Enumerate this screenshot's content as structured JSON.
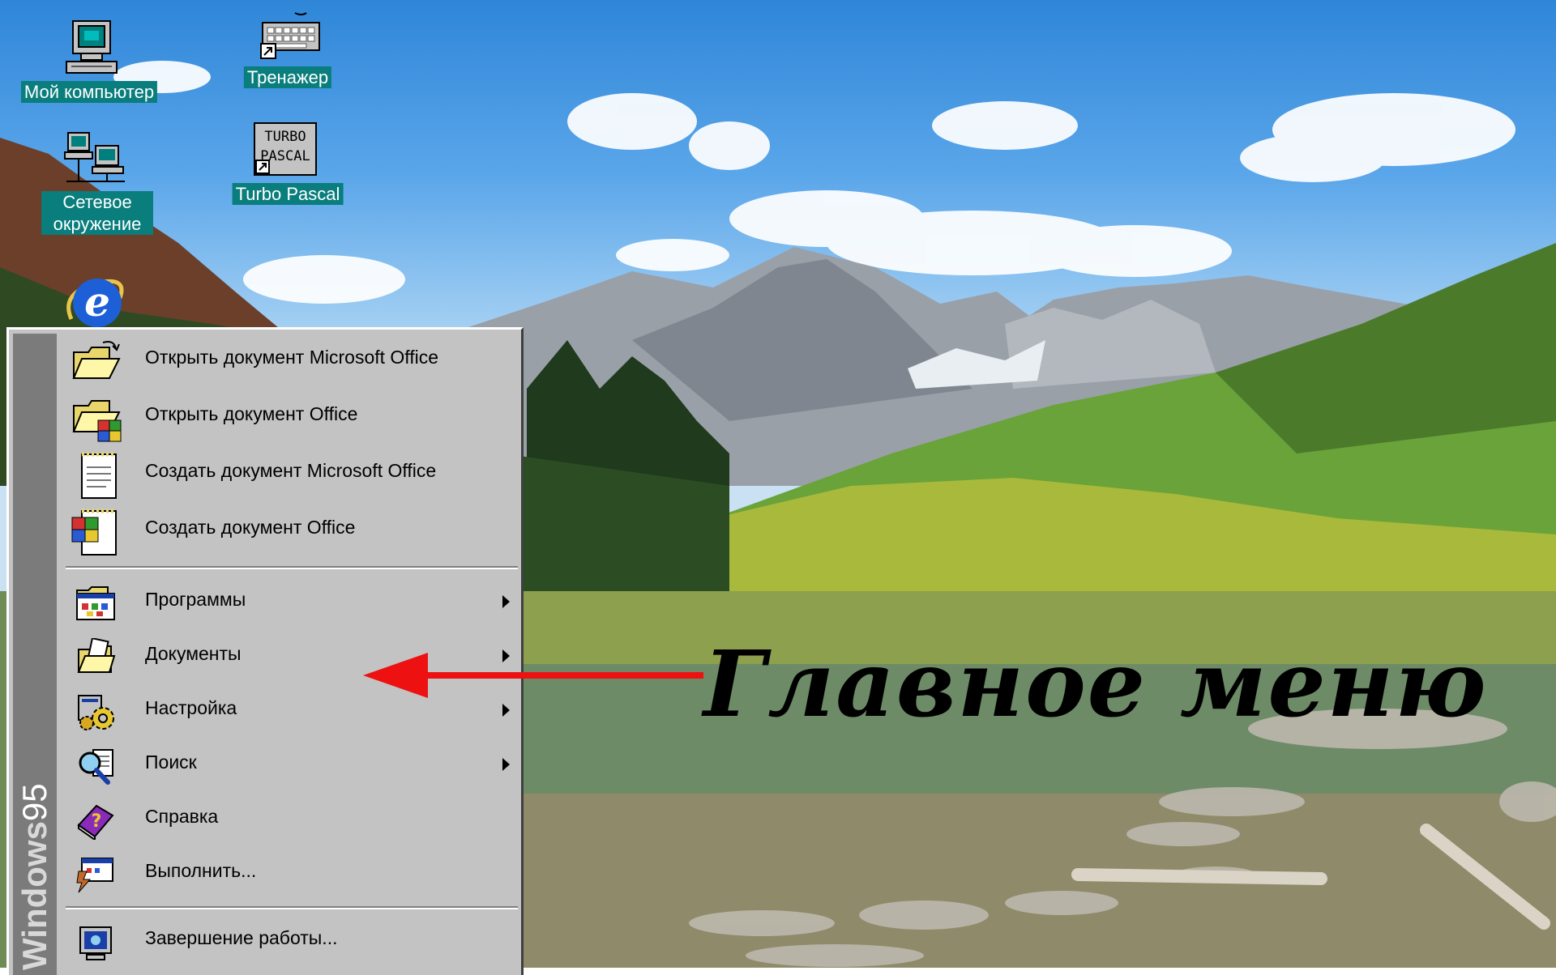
{
  "desktop": {
    "icons": [
      {
        "label": "Мой компьютер"
      },
      {
        "label": "Тренажер"
      },
      {
        "label": "Сетевое окружение"
      },
      {
        "label": "Turbo Pascal"
      }
    ],
    "turbo_pascal_logo": "TURBO PASCAL"
  },
  "start_menu": {
    "brand_bold": "Windows",
    "brand_version": "95",
    "office_items": [
      {
        "label": "Открыть документ Microsoft Office"
      },
      {
        "label": "Открыть документ Office"
      },
      {
        "label": "Создать документ Microsoft Office"
      },
      {
        "label": "Создать документ Office"
      }
    ],
    "items": [
      {
        "label": "Программы",
        "has_submenu": true
      },
      {
        "label": "Документы",
        "has_submenu": true
      },
      {
        "label": "Настройка",
        "has_submenu": true
      },
      {
        "label": "Поиск",
        "has_submenu": true
      },
      {
        "label": "Справка",
        "has_submenu": false
      },
      {
        "label": "Выполнить...",
        "has_submenu": false
      }
    ],
    "shutdown": {
      "label": "Завершение работы..."
    }
  },
  "annotation": {
    "text": "Главное меню",
    "arrow_color": "#ee1111"
  },
  "colors": {
    "menu_face": "#c3c3c3",
    "sidebar": "#7b7b7b",
    "icon_label_bg": "#0a7d7d"
  }
}
